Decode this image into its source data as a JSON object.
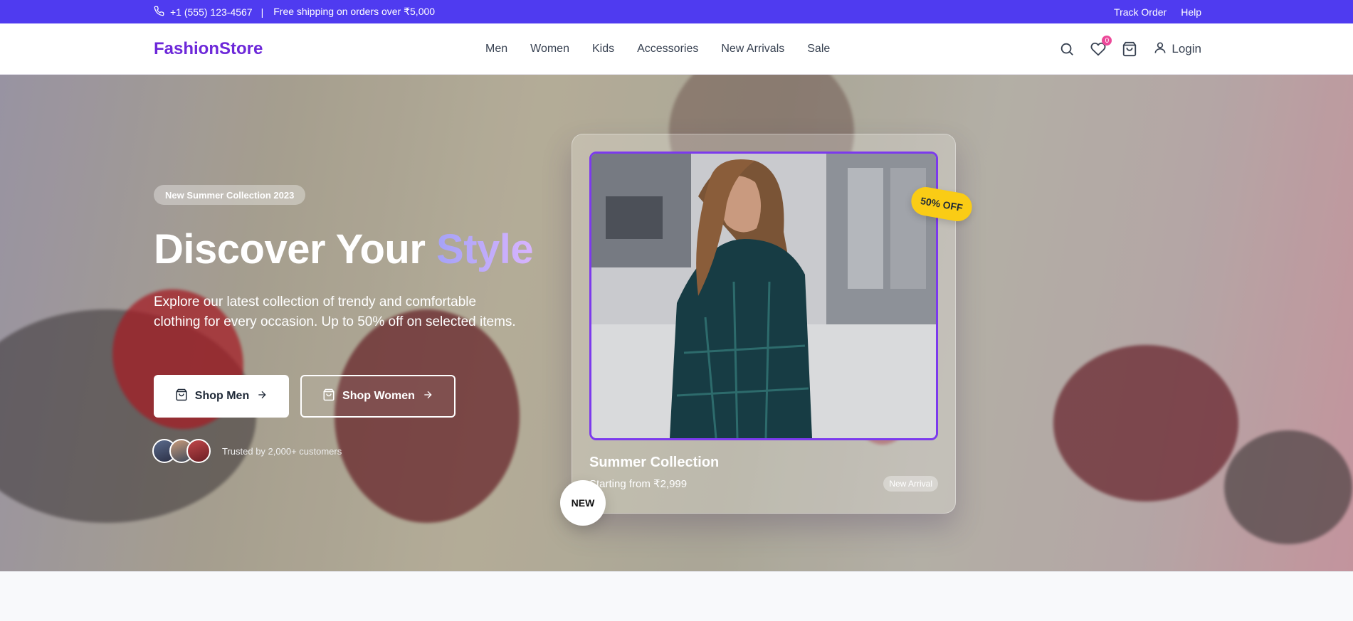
{
  "topbar": {
    "phone": "+1 (555) 123-4567",
    "separator": "|",
    "shipping": "Free shipping on orders over ₹5,000",
    "track_order": "Track Order",
    "help": "Help"
  },
  "navbar": {
    "logo": "FashionStore",
    "links": [
      "Men",
      "Women",
      "Kids",
      "Accessories",
      "New Arrivals",
      "Sale"
    ],
    "wishlist_count": "0",
    "login": "Login"
  },
  "hero": {
    "badge": "New Summer Collection 2023",
    "title_main": "Discover Your",
    "title_accent": "Style",
    "description": "Explore our latest collection of trendy and comfortable clothing for every occasion. Up to 50% off on selected items.",
    "btn_men": "Shop Men",
    "btn_women": "Shop Women",
    "trust_text": "Trusted by 2,000+ customers"
  },
  "card": {
    "title": "Summer Collection",
    "subtitle": "Starting from ₹2,999",
    "tag": "New Arrival",
    "discount_badge": "50% OFF",
    "new_badge": "NEW"
  },
  "colors": {
    "topbar": "#4f3bf0",
    "logo": "#6d28d9",
    "accent_border": "#7c3aed",
    "discount": "#facc15",
    "wishlist_badge": "#ec4899"
  }
}
